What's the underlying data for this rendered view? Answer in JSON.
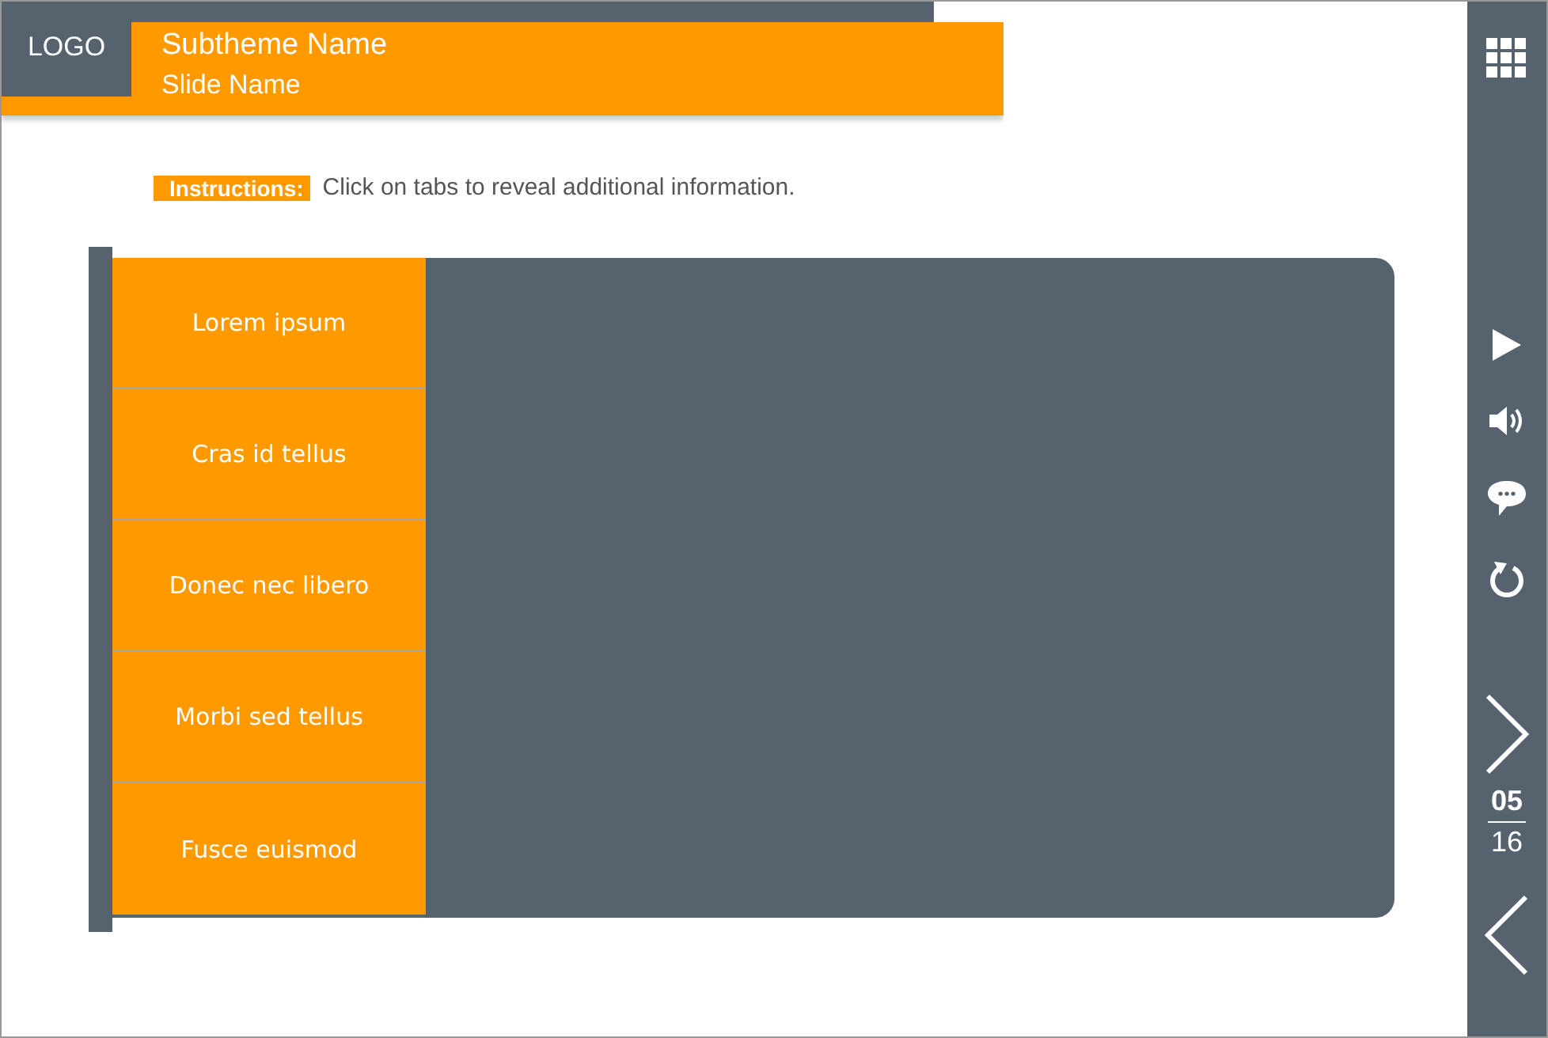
{
  "header": {
    "logo": "LOGO",
    "subtheme": "Subtheme Name",
    "slide": "Slide Name"
  },
  "instructions": {
    "label": "Instructions:",
    "text": "Click on tabs to reveal additional information."
  },
  "tabs": [
    {
      "label": "Lorem ipsum",
      "selected": false
    },
    {
      "label": "Cras id tellus",
      "selected": false
    },
    {
      "label": "Donec nec libero",
      "selected": false
    },
    {
      "label": "Morbi sed tellus",
      "selected": false
    },
    {
      "label": "Fusce euismod",
      "selected": false
    }
  ],
  "pager": {
    "current": "05",
    "total": "16"
  }
}
